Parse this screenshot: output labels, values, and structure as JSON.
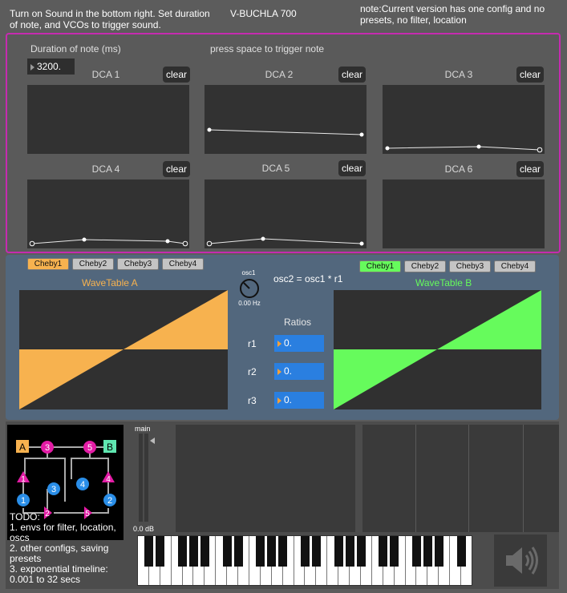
{
  "header": {
    "instructions": "Turn on Sound in the bottom right. Set duration of note, and VCOs to trigger sound.",
    "title": "V-BUCHLA 700",
    "note": "note:Current version has one config and no presets, no filter, location"
  },
  "envelopes": {
    "duration_label": "Duration of note (ms)",
    "duration_value": "3200.",
    "trigger_hint": "press space to trigger note",
    "clear_label": "clear",
    "dcas": [
      {
        "label": "DCA 1"
      },
      {
        "label": "DCA 2"
      },
      {
        "label": "DCA 3"
      },
      {
        "label": "DCA 4"
      },
      {
        "label": "DCA 5"
      },
      {
        "label": "DCA 6"
      }
    ]
  },
  "oscillators": {
    "tabs_a": [
      "Cheby1",
      "Cheby2",
      "Cheby3",
      "Cheby4"
    ],
    "tabs_b": [
      "Cheby1",
      "Cheby2",
      "Cheby3",
      "Cheby4"
    ],
    "active_tab_a": "Cheby1",
    "active_tab_b": "Cheby1",
    "wavetable_a": "WaveTable A",
    "wavetable_b": "WaveTable B",
    "osc_label": "osc1",
    "osc_freq": "0.00 Hz",
    "formula": "osc2 = osc1 * r1",
    "ratios_title": "Ratios",
    "ratios": [
      {
        "label": "r1",
        "value": "0."
      },
      {
        "label": "r2",
        "value": "0."
      },
      {
        "label": "r3",
        "value": "0."
      }
    ],
    "colors": {
      "a": "#f7b24f",
      "b": "#66fb5c"
    }
  },
  "routing": {
    "nodes": [
      "A",
      "3",
      "5",
      "B",
      "1",
      "3",
      "4",
      "4",
      "1",
      "2",
      "2",
      "5"
    ]
  },
  "mixer": {
    "main_label": "main",
    "db_value": "0.0 dB"
  },
  "todo": {
    "title": "TODO:",
    "items": [
      "1. envs for filter, location, oscs",
      "2. other configs, saving presets",
      "3. exponential timeline: 0.001 to 32 secs"
    ]
  }
}
